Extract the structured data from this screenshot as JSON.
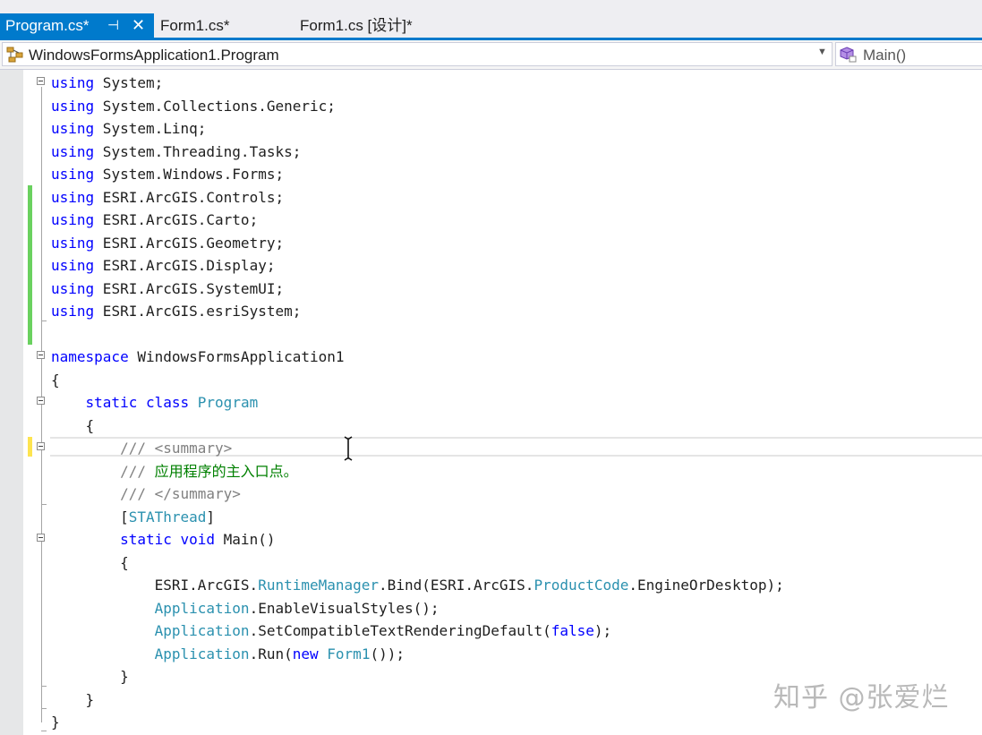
{
  "tabs": [
    {
      "label": "Program.cs*",
      "active": true,
      "pin_glyph": "⊣",
      "close_glyph": "✕"
    },
    {
      "label": "Form1.cs*",
      "active": false
    },
    {
      "label": "Form1.cs [设计]*",
      "active": false
    }
  ],
  "navbar": {
    "type_selector": "WindowsFormsApplication1.Program",
    "member_selector": "Main()",
    "type_icon": "class-icon",
    "member_icon": "method-icon",
    "dropdown_glyph": "▼"
  },
  "code": {
    "lines": [
      [
        {
          "t": "using",
          "c": "kw"
        },
        {
          "t": " System;",
          "c": "pl"
        }
      ],
      [
        {
          "t": "using",
          "c": "kw"
        },
        {
          "t": " System.Collections.Generic;",
          "c": "pl"
        }
      ],
      [
        {
          "t": "using",
          "c": "kw"
        },
        {
          "t": " System.Linq;",
          "c": "pl"
        }
      ],
      [
        {
          "t": "using",
          "c": "kw"
        },
        {
          "t": " System.Threading.Tasks;",
          "c": "pl"
        }
      ],
      [
        {
          "t": "using",
          "c": "kw"
        },
        {
          "t": " System.Windows.Forms;",
          "c": "pl"
        }
      ],
      [
        {
          "t": "using",
          "c": "kw"
        },
        {
          "t": " ESRI.ArcGIS.Controls;",
          "c": "pl"
        }
      ],
      [
        {
          "t": "using",
          "c": "kw"
        },
        {
          "t": " ESRI.ArcGIS.Carto;",
          "c": "pl"
        }
      ],
      [
        {
          "t": "using",
          "c": "kw"
        },
        {
          "t": " ESRI.ArcGIS.Geometry;",
          "c": "pl"
        }
      ],
      [
        {
          "t": "using",
          "c": "kw"
        },
        {
          "t": " ESRI.ArcGIS.Display;",
          "c": "pl"
        }
      ],
      [
        {
          "t": "using",
          "c": "kw"
        },
        {
          "t": " ESRI.ArcGIS.SystemUI;",
          "c": "pl"
        }
      ],
      [
        {
          "t": "using",
          "c": "kw"
        },
        {
          "t": " ESRI.ArcGIS.esriSystem;",
          "c": "pl"
        }
      ],
      [],
      [
        {
          "t": "namespace",
          "c": "kw"
        },
        {
          "t": " WindowsFormsApplication1",
          "c": "pl"
        }
      ],
      [
        {
          "t": "{",
          "c": "pl"
        }
      ],
      [
        {
          "t": "    ",
          "c": "pl"
        },
        {
          "t": "static",
          "c": "kw"
        },
        {
          "t": " ",
          "c": "pl"
        },
        {
          "t": "class",
          "c": "kw"
        },
        {
          "t": " ",
          "c": "pl"
        },
        {
          "t": "Program",
          "c": "ty"
        }
      ],
      [
        {
          "t": "    {",
          "c": "pl"
        }
      ],
      [
        {
          "t": "        /// <summary>",
          "c": "xd"
        }
      ],
      [
        {
          "t": "        /// ",
          "c": "xd"
        },
        {
          "t": "应用程序的主入口点。",
          "c": "cm"
        }
      ],
      [
        {
          "t": "        /// </summary>",
          "c": "xd"
        }
      ],
      [
        {
          "t": "        [",
          "c": "pl"
        },
        {
          "t": "STAThread",
          "c": "ty"
        },
        {
          "t": "]",
          "c": "pl"
        }
      ],
      [
        {
          "t": "        ",
          "c": "pl"
        },
        {
          "t": "static",
          "c": "kw"
        },
        {
          "t": " ",
          "c": "pl"
        },
        {
          "t": "void",
          "c": "kw"
        },
        {
          "t": " Main()",
          "c": "pl"
        }
      ],
      [
        {
          "t": "        {",
          "c": "pl"
        }
      ],
      [
        {
          "t": "            ESRI.ArcGIS.",
          "c": "pl"
        },
        {
          "t": "RuntimeManager",
          "c": "ty"
        },
        {
          "t": ".Bind(ESRI.ArcGIS.",
          "c": "pl"
        },
        {
          "t": "ProductCode",
          "c": "ty"
        },
        {
          "t": ".EngineOrDesktop);",
          "c": "pl"
        }
      ],
      [
        {
          "t": "            ",
          "c": "pl"
        },
        {
          "t": "Application",
          "c": "ty"
        },
        {
          "t": ".EnableVisualStyles();",
          "c": "pl"
        }
      ],
      [
        {
          "t": "            ",
          "c": "pl"
        },
        {
          "t": "Application",
          "c": "ty"
        },
        {
          "t": ".SetCompatibleTextRenderingDefault(",
          "c": "pl"
        },
        {
          "t": "false",
          "c": "kw"
        },
        {
          "t": ");",
          "c": "pl"
        }
      ],
      [
        {
          "t": "            ",
          "c": "pl"
        },
        {
          "t": "Application",
          "c": "ty"
        },
        {
          "t": ".Run(",
          "c": "pl"
        },
        {
          "t": "new",
          "c": "kw"
        },
        {
          "t": " ",
          "c": "pl"
        },
        {
          "t": "Form1",
          "c": "ty"
        },
        {
          "t": "());",
          "c": "pl"
        }
      ],
      [
        {
          "t": "        }",
          "c": "pl"
        }
      ],
      [
        {
          "t": "    }",
          "c": "pl"
        }
      ],
      [
        {
          "t": "}",
          "c": "pl"
        }
      ]
    ]
  },
  "colors": {
    "keyword": "#0000ff",
    "type": "#2b91af",
    "comment": "#008000",
    "xml_doc": "#808080",
    "accent": "#007acc",
    "changed_saved": "#6ad15f",
    "changed_unsaved": "#fde450"
  },
  "watermark": "知乎 @张爱烂"
}
